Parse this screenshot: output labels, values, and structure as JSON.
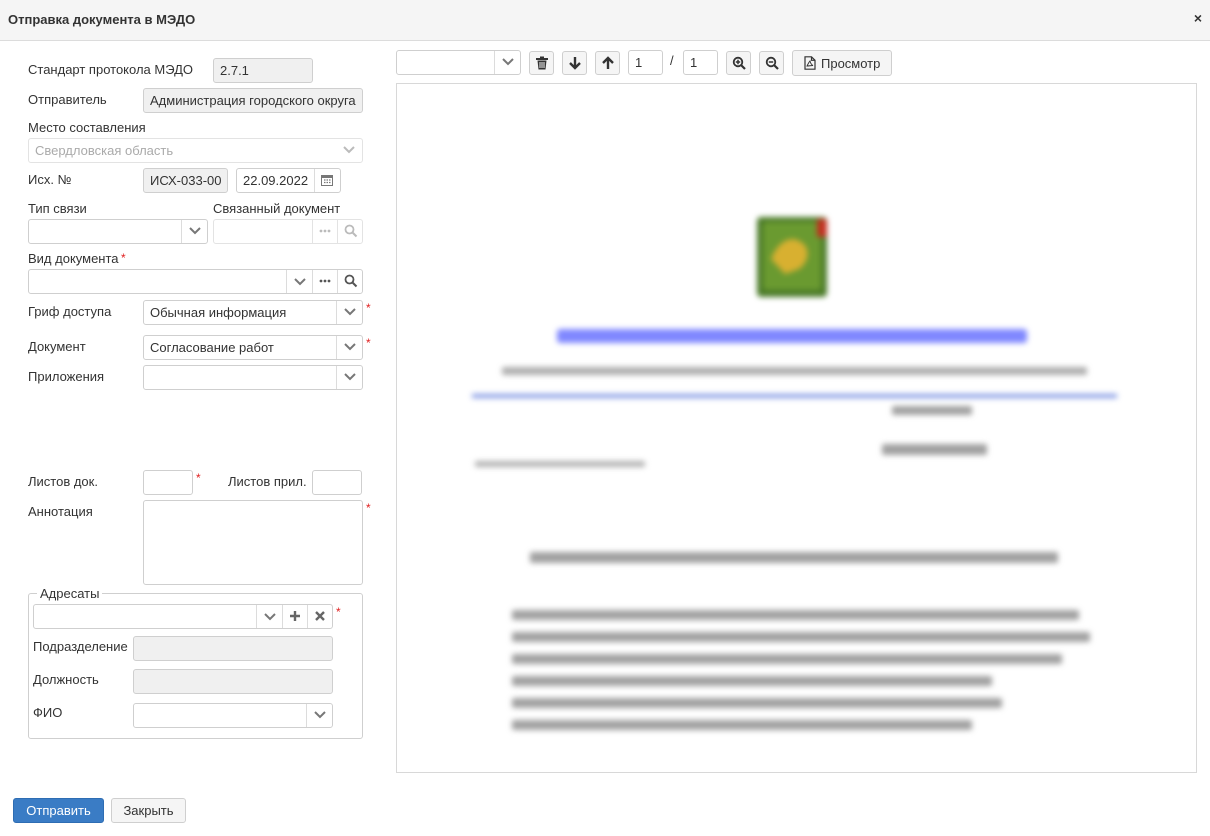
{
  "dialog": {
    "title": "Отправка документа в МЭДО",
    "close_glyph": "×"
  },
  "form": {
    "protocol": {
      "label": "Стандарт протокола МЭДО",
      "value": "2.7.1"
    },
    "sender": {
      "label": "Отправитель",
      "value": "Администрация городского округа"
    },
    "place": {
      "label": "Место составления",
      "value": "Свердловская область"
    },
    "out_number": {
      "label": "Исх. №",
      "value": "ИСХ-033-00",
      "date": "22.09.2022"
    },
    "link_type": {
      "label": "Тип связи",
      "value": ""
    },
    "linked_doc": {
      "label": "Связанный документ",
      "value": ""
    },
    "doc_kind": {
      "label": "Вид документа",
      "value": ""
    },
    "access": {
      "label": "Гриф доступа",
      "value": "Обычная информация"
    },
    "document": {
      "label": "Документ",
      "value": "Согласование работ"
    },
    "attachments": {
      "label": "Приложения",
      "value": ""
    },
    "sheets_doc": {
      "label": "Листов док.",
      "value": ""
    },
    "sheets_att": {
      "label": "Листов прил.",
      "value": ""
    },
    "annotation": {
      "label": "Аннотация",
      "value": ""
    },
    "required_mark": "*"
  },
  "recipients": {
    "legend": "Адресаты",
    "addressee": {
      "value": ""
    },
    "department": {
      "label": "Подразделение",
      "value": ""
    },
    "position": {
      "label": "Должность",
      "value": ""
    },
    "fio": {
      "label": "ФИО",
      "value": ""
    }
  },
  "viewer": {
    "page_current": "1",
    "page_separator": "/",
    "page_total": "1",
    "preview_label": "Просмотр"
  },
  "colors": {
    "primary": "#3a7cc5",
    "required": "#e02020"
  },
  "footer": {
    "send_label": "Отправить",
    "close_label": "Закрыть"
  }
}
